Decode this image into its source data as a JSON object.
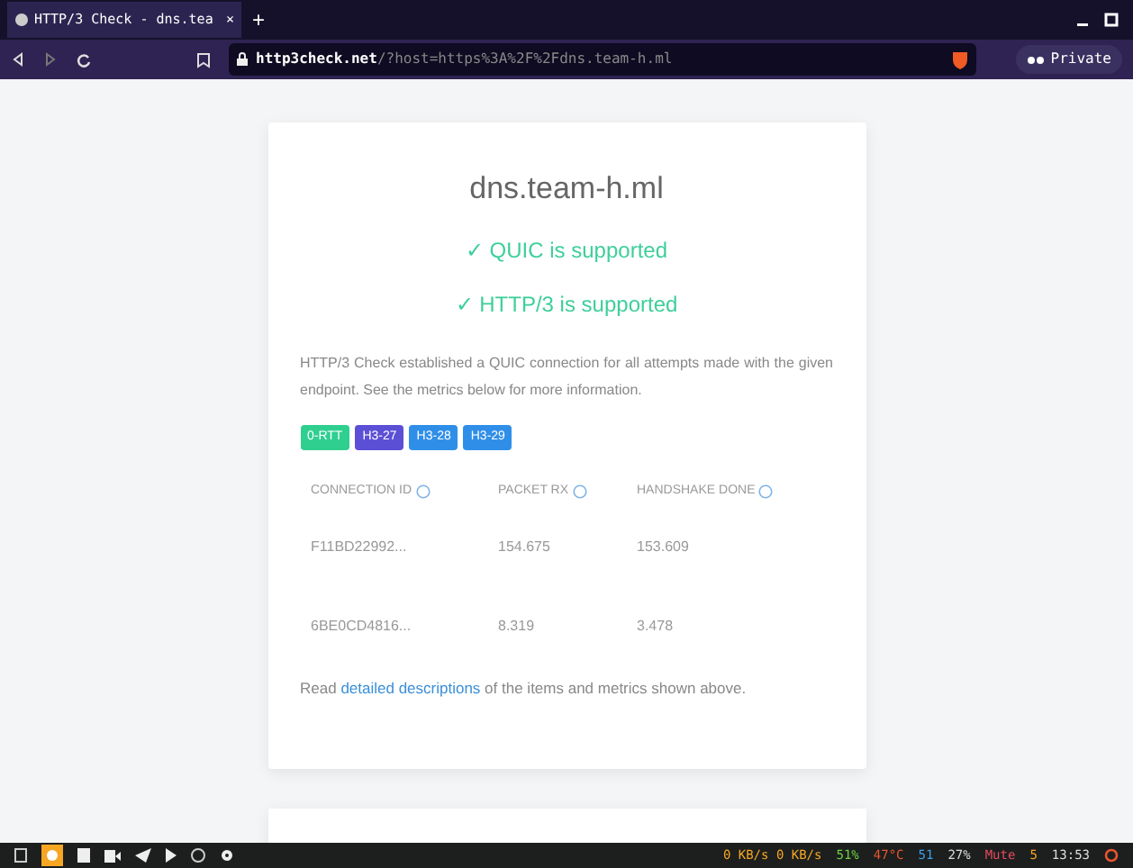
{
  "browser": {
    "tab_title": "HTTP/3 Check - dns.tea",
    "close_tab": "×",
    "new_tab": "+",
    "url_domain": "http3check.net",
    "url_path": "/?host=https%3A%2F%2Fdns.team-h.ml",
    "private_label": "Private"
  },
  "card": {
    "host": "dns.team-h.ml",
    "checks": [
      {
        "text": "✓ QUIC is supported"
      },
      {
        "text": "✓ HTTP/3 is supported"
      }
    ],
    "description": "HTTP/3 Check established a QUIC connection for all attempts made with the given endpoint. See the metrics below for more information.",
    "badges": [
      {
        "label": "0-RTT",
        "color": "#2fcf8f"
      },
      {
        "label": "H3-27",
        "color": "#5b4fd6"
      },
      {
        "label": "H3-28",
        "color": "#2f8fe8"
      },
      {
        "label": "H3-29",
        "color": "#2f8fe8"
      }
    ],
    "table": {
      "columns": [
        "CONNECTION ID",
        "PACKET RX",
        "HANDSHAKE DONE"
      ],
      "rows": [
        [
          "F11BD22992...",
          "154.675",
          "153.609"
        ],
        [
          "6BE0CD4816...",
          "8.319",
          "3.478"
        ]
      ]
    },
    "footer_before": "Read ",
    "footer_link": "detailed descriptions",
    "footer_after": " of the items and metrics shown above."
  },
  "taskbar": {
    "net": "0 KB/s 0 KB/s",
    "memory": "51%",
    "temp": "47°C",
    "disk": "51",
    "battery": "27%",
    "volume": "Mute",
    "updates": "5",
    "clock": "13:53"
  }
}
